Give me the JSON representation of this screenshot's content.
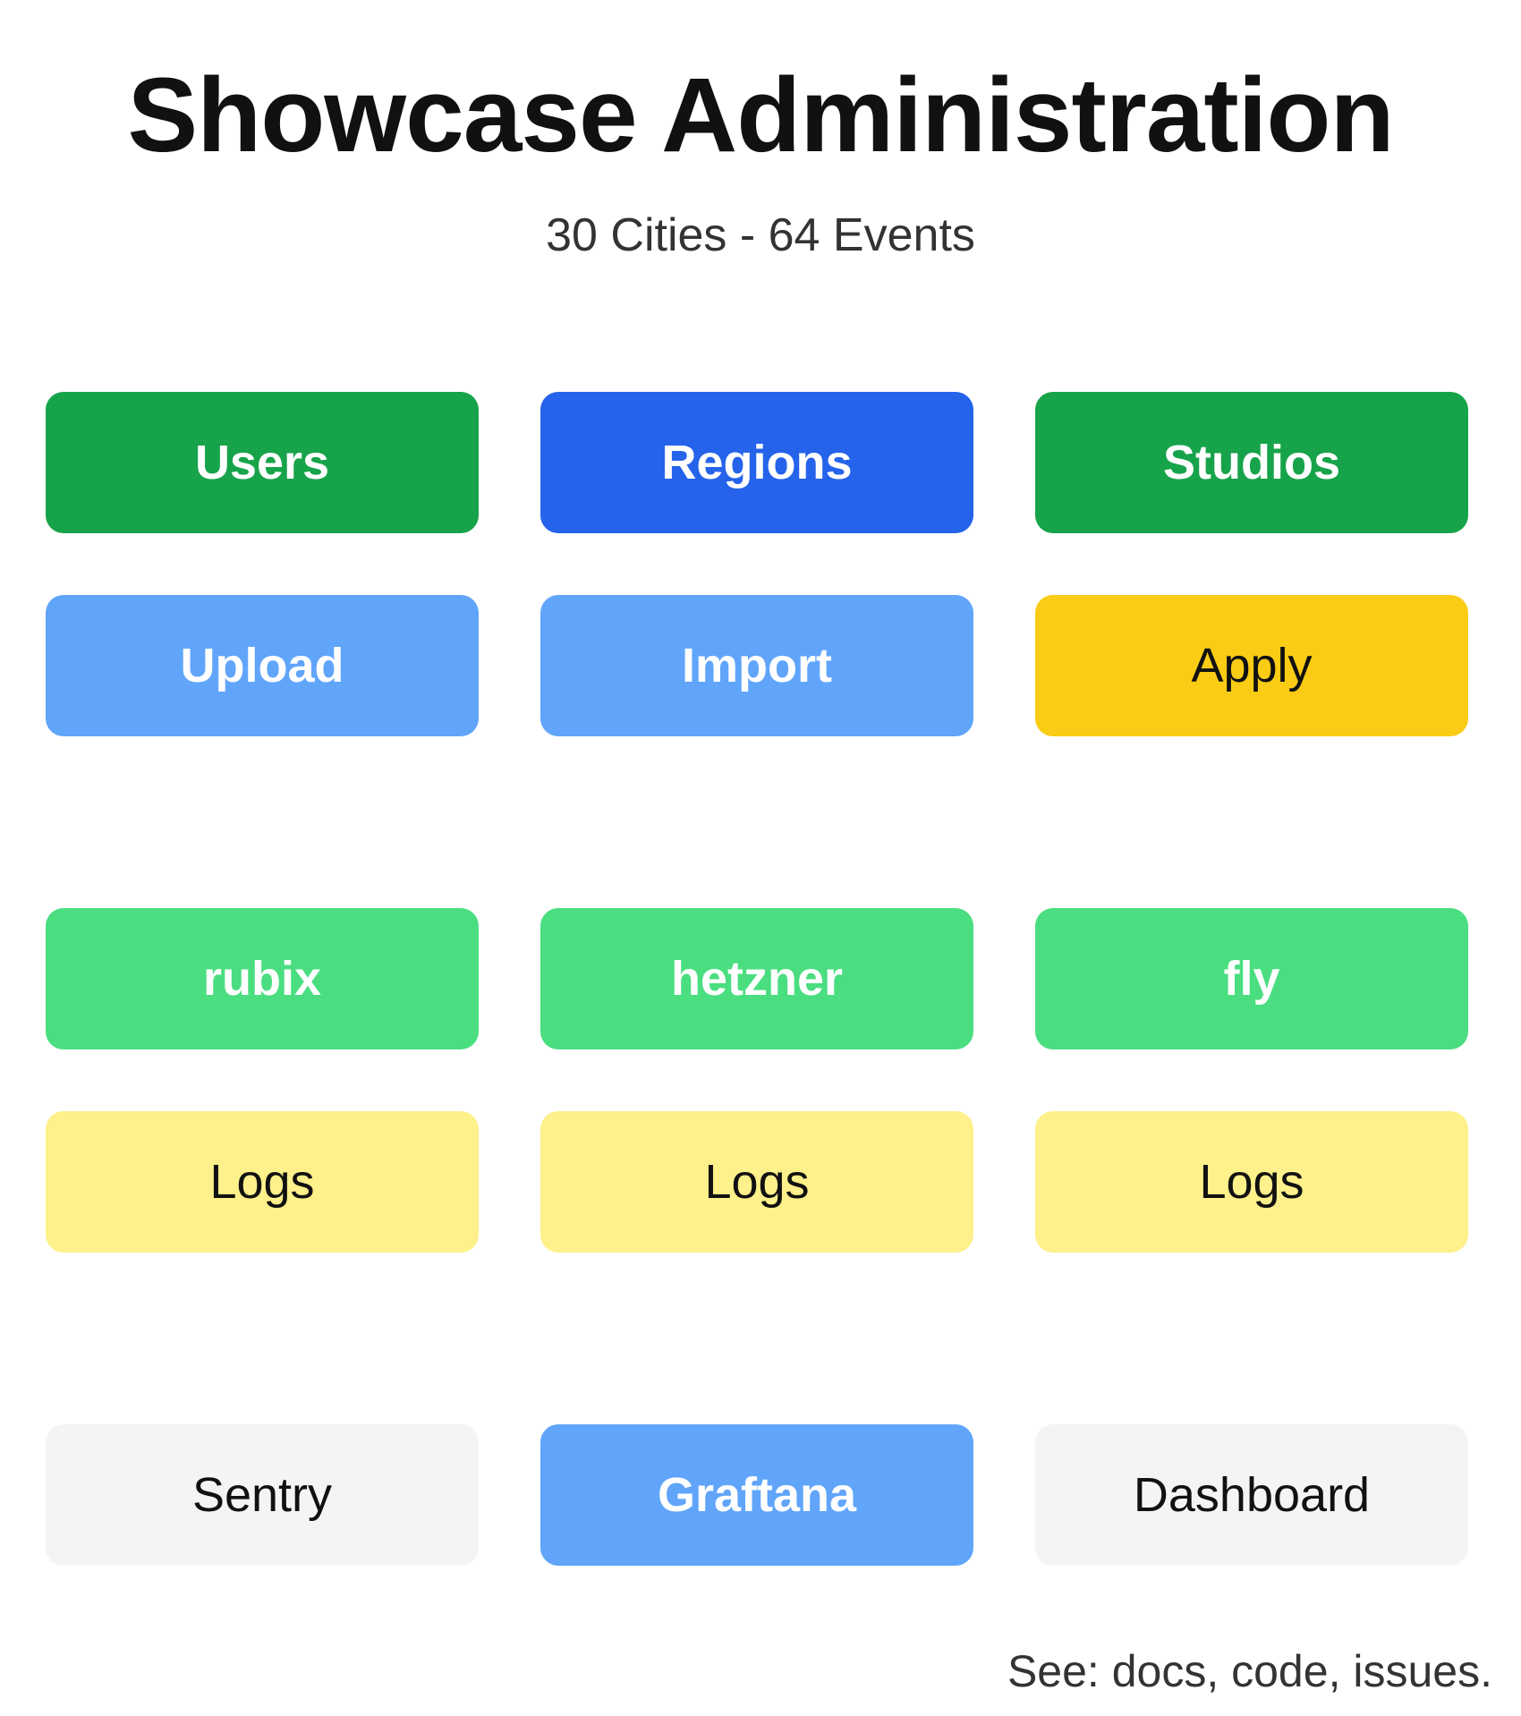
{
  "header": {
    "title": "Showcase Administration",
    "subtitle": "30 Cities - 64 Events"
  },
  "admin_buttons": [
    {
      "label": "Users",
      "bg": "#17a34a",
      "fg": "#ffffff"
    },
    {
      "label": "Regions",
      "bg": "#2563eb",
      "fg": "#ffffff"
    },
    {
      "label": "Studios",
      "bg": "#17a34a",
      "fg": "#ffffff"
    },
    {
      "label": "Upload",
      "bg": "#60a5fa",
      "fg": "#ffffff"
    },
    {
      "label": "Import",
      "bg": "#60a5fa",
      "fg": "#ffffff"
    },
    {
      "label": "Apply",
      "bg": "#facc15",
      "fg": "#111111"
    }
  ],
  "host_buttons": [
    {
      "label": "rubix",
      "bg": "#4ade80",
      "fg": "#ffffff"
    },
    {
      "label": "hetzner",
      "bg": "#4ade80",
      "fg": "#ffffff"
    },
    {
      "label": "fly",
      "bg": "#4ade80",
      "fg": "#ffffff"
    },
    {
      "label": "Logs",
      "bg": "#fef08a",
      "fg": "#111111"
    },
    {
      "label": "Logs",
      "bg": "#fef08a",
      "fg": "#111111"
    },
    {
      "label": "Logs",
      "bg": "#fef08a",
      "fg": "#111111"
    }
  ],
  "monitoring_buttons": [
    {
      "label": "Sentry",
      "bg": "#f3f4f6",
      "fg": "#111111"
    },
    {
      "label": "Graftana",
      "bg": "#60a5fa",
      "fg": "#ffffff"
    },
    {
      "label": "Dashboard",
      "bg": "#f3f4f6",
      "fg": "#111111"
    }
  ],
  "footer": {
    "prefix": "See: ",
    "docs": "docs",
    "sep1": ", ",
    "code": "code",
    "sep2": ", ",
    "issues": "issues",
    "suffix": "."
  }
}
